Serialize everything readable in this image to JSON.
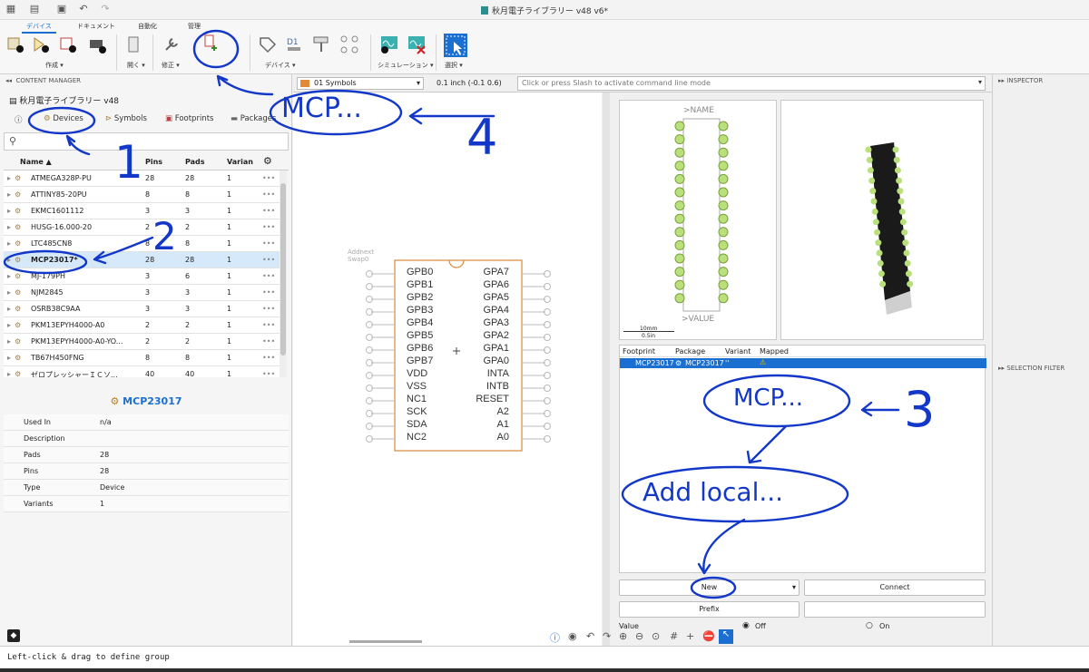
{
  "window": {
    "title": "秋月電子ライブラリー v48 v6*"
  },
  "ribbon": {
    "tabs": [
      "デバイス",
      "ドキュメント",
      "自動化",
      "管理"
    ],
    "groups": [
      "作成 ▾",
      "開く ▾",
      "修正 ▾",
      "デバイス ▾",
      "シミュレーション ▾",
      "選択 ▾"
    ]
  },
  "content_manager": {
    "header": "CONTENT MANAGER",
    "library_name": "秋月電子ライブラリー v48",
    "tabs": [
      "Devices",
      "Symbols",
      "Footprints",
      "Packages"
    ],
    "columns": [
      "Name ▲",
      "Pins",
      "Pads",
      "Varian"
    ],
    "rows": [
      {
        "name": "ATMEGA328P-PU",
        "pins": "28",
        "pads": "28",
        "variants": "1"
      },
      {
        "name": "ATTINY85-20PU",
        "pins": "8",
        "pads": "8",
        "variants": "1"
      },
      {
        "name": "EKMC1601112",
        "pins": "3",
        "pads": "3",
        "variants": "1"
      },
      {
        "name": "HUSG-16.000-20",
        "pins": "2",
        "pads": "2",
        "variants": "1"
      },
      {
        "name": "LTC485CN8",
        "pins": "8",
        "pads": "8",
        "variants": "1"
      },
      {
        "name": "MCP23017*",
        "pins": "28",
        "pads": "28",
        "variants": "1"
      },
      {
        "name": "MJ-179PH",
        "pins": "3",
        "pads": "6",
        "variants": "1"
      },
      {
        "name": "NJM2845",
        "pins": "3",
        "pads": "3",
        "variants": "1"
      },
      {
        "name": "OSRB38C9AA",
        "pins": "3",
        "pads": "3",
        "variants": "1"
      },
      {
        "name": "PKM13EPYH4000-A0",
        "pins": "2",
        "pads": "2",
        "variants": "1"
      },
      {
        "name": "PKM13EPYH4000-A0-YO...",
        "pins": "2",
        "pads": "2",
        "variants": "1"
      },
      {
        "name": "TB67H450FNG",
        "pins": "8",
        "pads": "8",
        "variants": "1"
      },
      {
        "name": "ゼロプレッシャーＩＣソ...",
        "pins": "40",
        "pads": "40",
        "variants": "1"
      }
    ],
    "selected_title": "MCP23017",
    "properties": [
      {
        "key": "Used In",
        "value": "n/a"
      },
      {
        "key": "Description",
        "value": ""
      },
      {
        "key": "Pads",
        "value": "28"
      },
      {
        "key": "Pins",
        "value": "28"
      },
      {
        "key": "Type",
        "value": "Device"
      },
      {
        "key": "Variants",
        "value": "1"
      }
    ]
  },
  "view_toolbar": {
    "symbol_select": "01 Symbols",
    "grid": "0.1 inch (-0.1 0.6)",
    "command_placeholder": "Click or press Slash to activate command line mode"
  },
  "symbol": {
    "add_next": "Addnext",
    "swap": "Swap0",
    "left_pins": [
      "GPB0",
      "GPB1",
      "GPB2",
      "GPB3",
      "GPB4",
      "GPB5",
      "GPB6",
      "GPB7",
      "VDD",
      "VSS",
      "NC1",
      "SCK",
      "SDA",
      "NC2"
    ],
    "right_pins": [
      "GPA7",
      "GPA6",
      "GPA5",
      "GPA4",
      "GPA3",
      "GPA2",
      "GPA1",
      "GPA0",
      "INTA",
      "INTB",
      "RESET",
      "A2",
      "A1",
      "A0"
    ]
  },
  "footprint_preview": {
    "name": ">NAME",
    "value": ">VALUE",
    "scale_mm": "10mm",
    "scale_in": "0.5in"
  },
  "variants_table": {
    "columns": [
      "Footprint",
      "Package",
      "Variant",
      "Mapped"
    ],
    "row": {
      "footprint": "MCP23017",
      "package": "MCP23017",
      "variant": "''",
      "mapped": "⚠"
    }
  },
  "buttons": {
    "new": "New",
    "connect": "Connect",
    "prefix": "Prefix"
  },
  "value_option": {
    "label": "Value",
    "off": "Off",
    "on": "On"
  },
  "inspector": {
    "title": "INSPECTOR",
    "selection_filter": "SELECTION FILTER"
  },
  "status": {
    "text": "Left-click & drag to define group"
  },
  "annotations": {
    "mcp_top": "MCP...",
    "n4": "4",
    "n1": "1",
    "n2": "2",
    "n3": "3",
    "mcp_right": "MCP...",
    "add_local": "Add local..."
  },
  "colors": {
    "accent": "#1a6fd1",
    "annotation": "#1237c9",
    "symbol_outline": "#d98a3a",
    "selected_row": "#d6e9fb"
  }
}
